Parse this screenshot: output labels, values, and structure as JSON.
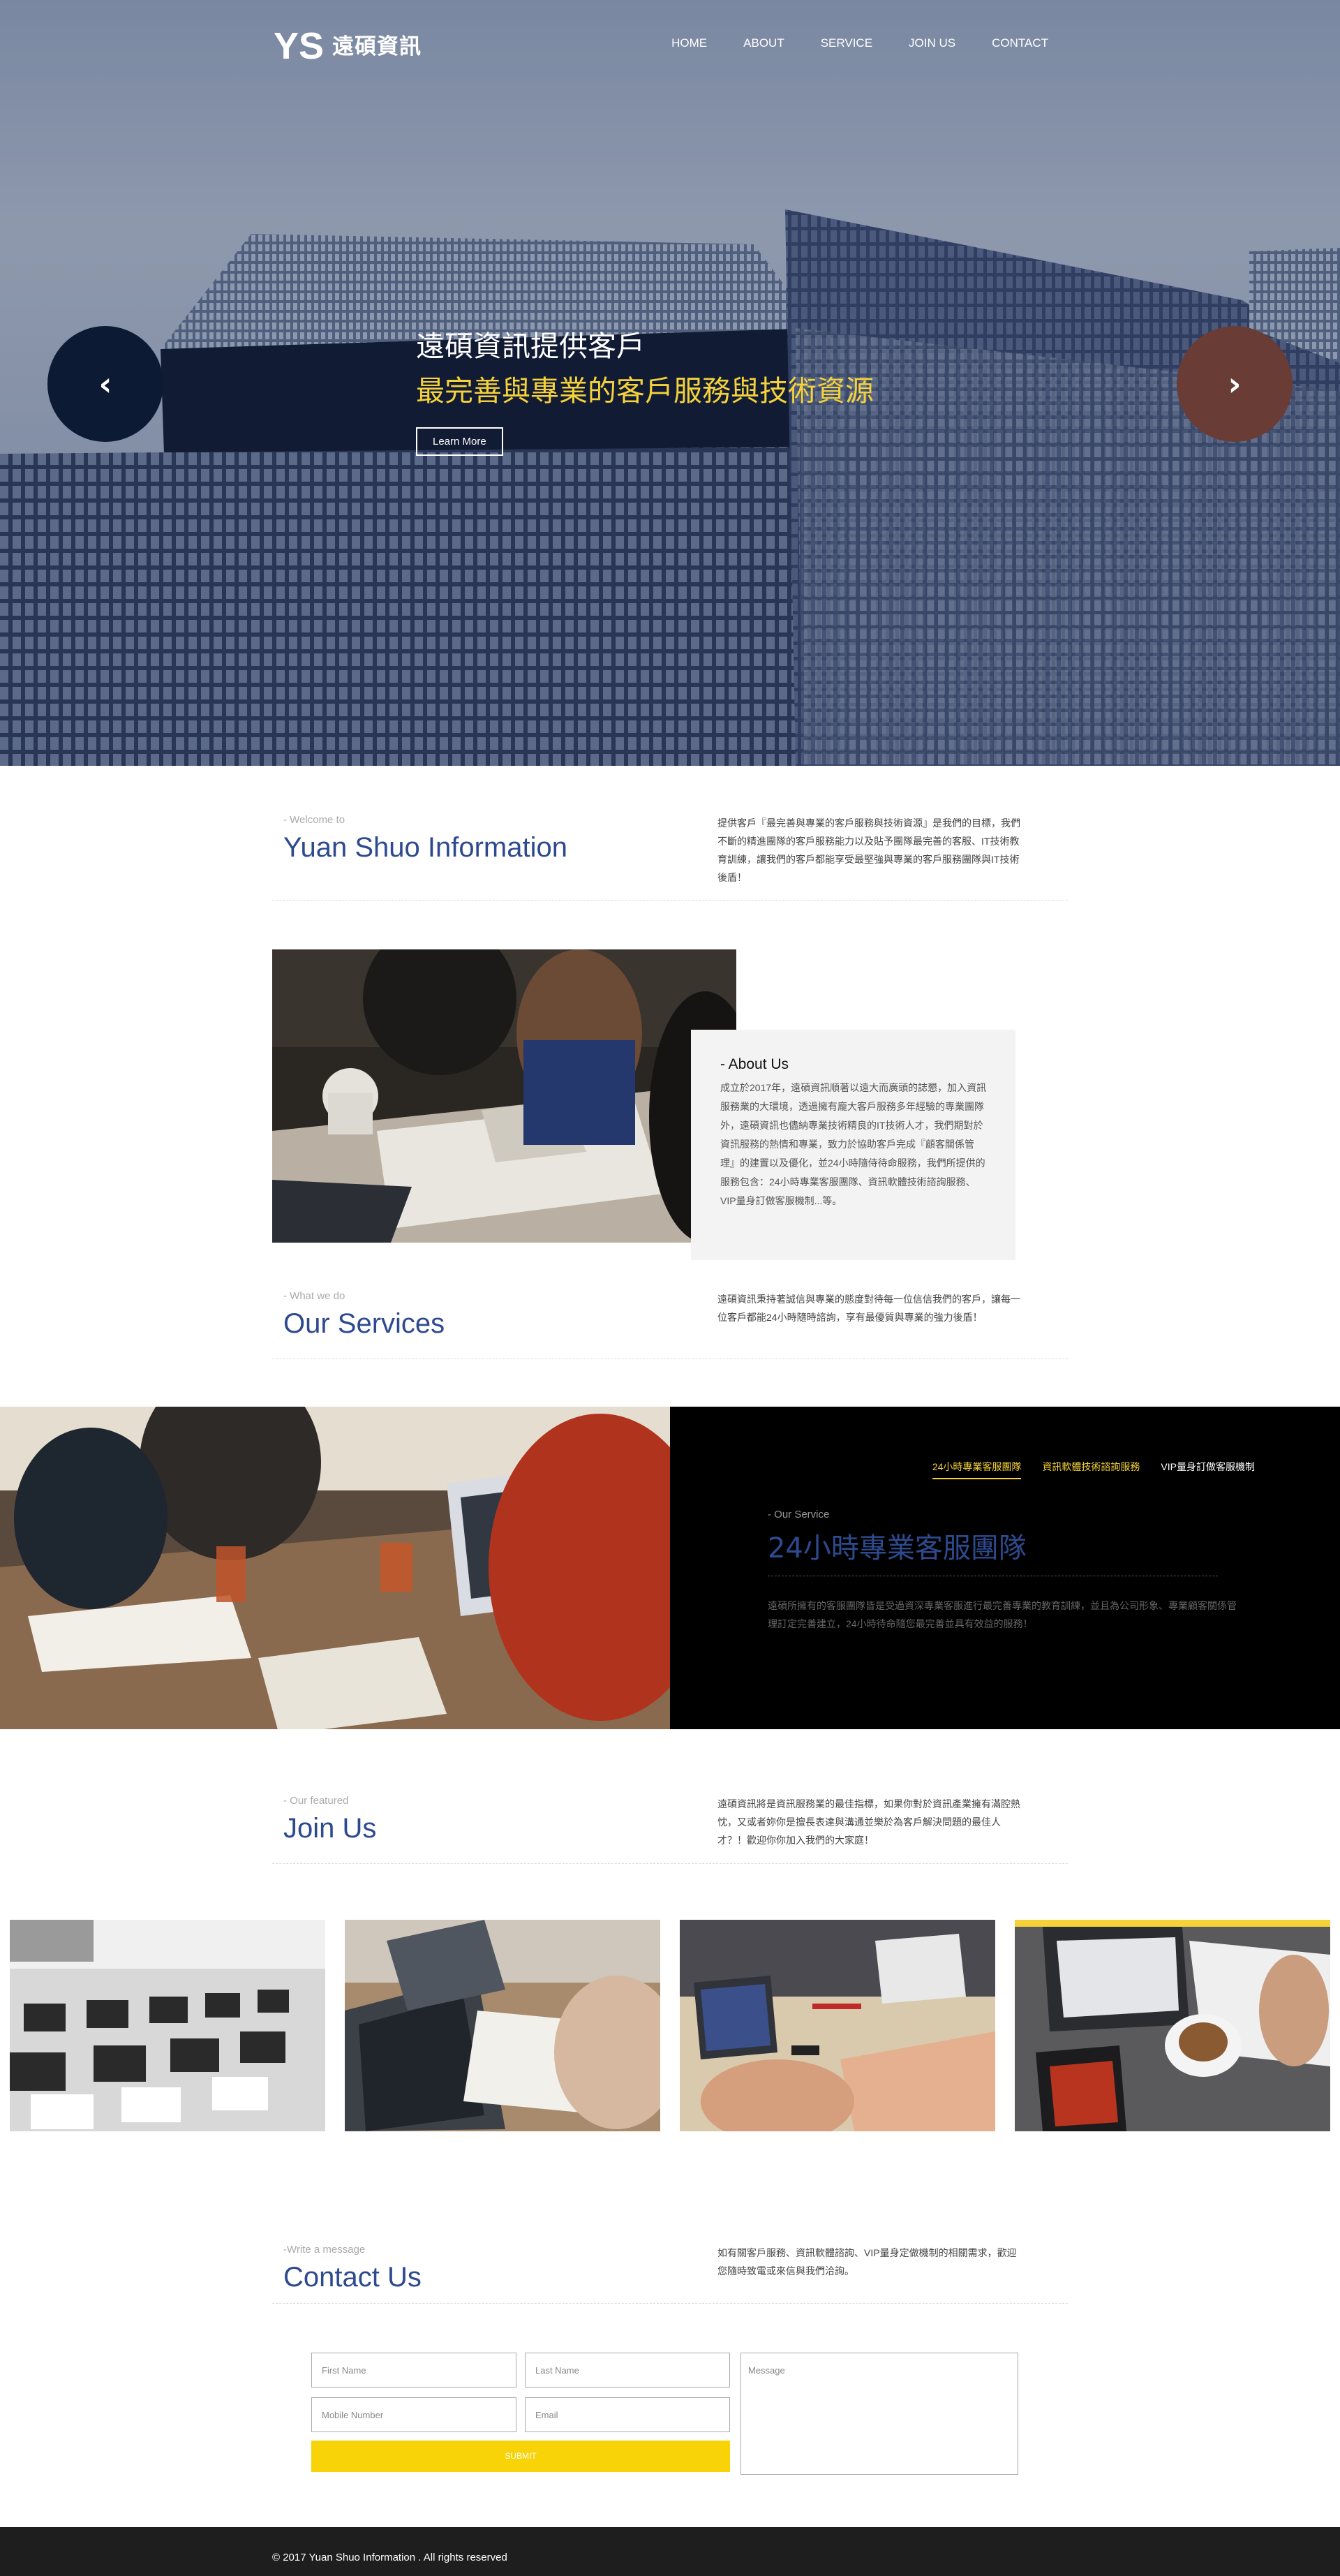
{
  "brand": {
    "logo_letters": "YS",
    "name": "遠碩資訊"
  },
  "nav": [
    "HOME",
    "ABOUT",
    "SERVICE",
    "JOIN US",
    "CONTACT"
  ],
  "hero": {
    "line1": "遠碩資訊提供客戶",
    "line2": "最完善與專業的客戶服務與技術資源",
    "button": "Learn More",
    "prev": "‹",
    "next": "›"
  },
  "welcome": {
    "kicker": "- Welcome to",
    "title": "Yuan Shuo Information",
    "desc": "提供客戶『最完善與專業的客戶服務與技術資源』是我們的目標，我們不斷的精進團隊的客戶服務能力以及貼予團隊最完善的客服、IT技術教育訓練，讓我們的客戶都能享受最堅強與專業的客戶服務團隊與IT技術後盾！"
  },
  "about": {
    "title": "- About Us",
    "text": "成立於2017年，遠碩資訊順著以遠大而廣頭的誌懇，加入資訊服務業的大環境，透過擁有龐大客戶服務多年經驗的專業團隊外，遠碩資訊也儘納專業技術精良的IT技術人才，我們期對於資訊服務的熱情和專業，致力於協助客戶完成『顧客關係管理』的建置以及優化，並24小時隨侍待命服務，我們所提供的服務包含：24小時專業客服團隊、資訊軟體技術諮詢服務、VIP量身訂做客服機制...等。"
  },
  "services": {
    "kicker": "- What we do",
    "title": "Our Services",
    "desc": "遠碩資訊秉持著誠信與專業的態度對待每一位信信我們的客戶，讓每一位客戶都能24小時隨時諮詢，享有最優質與專業的強力後盾！"
  },
  "band": {
    "tabs": [
      "24小時專業客服團隊",
      "資訊軟體技術諮詢服務",
      "VIP量身訂做客服機制"
    ],
    "kicker": "- Our Service",
    "title": "24小時專業客服團隊",
    "text": "遠碩所擁有的客服團隊皆是受過資深專業客服進行最完善專業的教育訓練，並且為公司形象、專業顧客關係管理訂定完善建立，24小時待命隨您最完善並具有效益的服務！"
  },
  "join": {
    "kicker": "- Our featured",
    "title": "Join Us",
    "desc": "遠碩資訊將是資訊服務業的最佳指標，如果你對於資訊產業擁有滿腔熱忱，又或者妳你是擅長表達與溝通並樂於為客戶解決問題的最佳人才？！歡迎你你加入我們的大家庭！"
  },
  "contact": {
    "kicker": "-Write a message",
    "title": "Contact Us",
    "desc": "如有關客戶服務、資訊軟體諮詢、VIP量身定做機制的相關需求，歡迎您隨時致電或來信與我們洽詢。",
    "first_name": "First Name",
    "last_name": "Last Name",
    "mobile": "Mobile Number",
    "email": "Email",
    "message": "Message",
    "submit": "SUBMIT"
  },
  "footer": {
    "copyright": "© 2017 Yuan Shuo Information . All rights reserved"
  },
  "colors": {
    "accent_blue": "#2e4a8f",
    "accent_yellow": "#f5d23a",
    "dark": "#000000"
  },
  "icons": [
    "chevron-left-icon",
    "chevron-right-icon"
  ]
}
